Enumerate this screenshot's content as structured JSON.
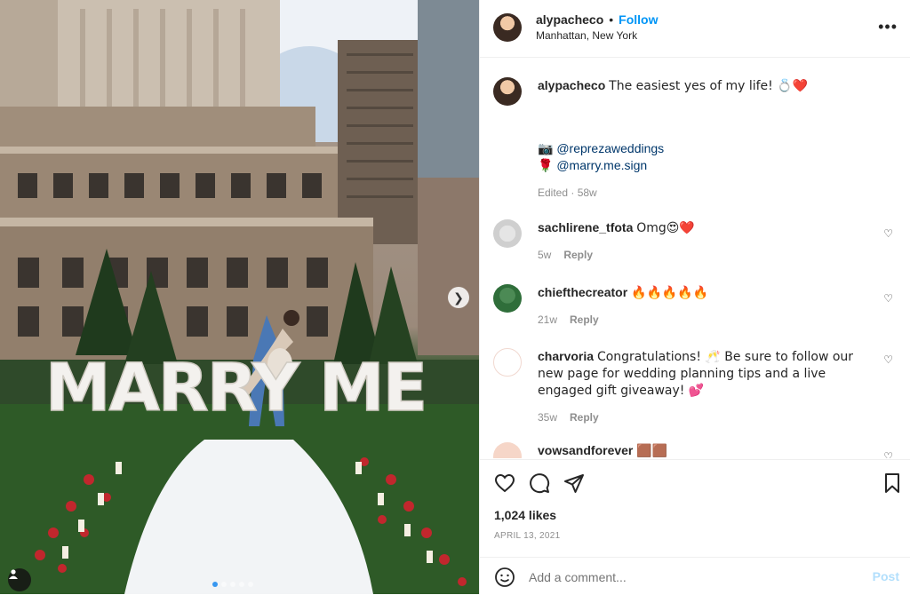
{
  "post": {
    "author": "alypacheco",
    "follow_label": "Follow",
    "location": "Manhattan, New York",
    "caption": {
      "text": "The easiest yes of my life! 💍❤️",
      "credit1_emoji": "📷",
      "credit1": "@reprezaweddings",
      "credit2_emoji": "🌹",
      "credit2": "@marry.me.sign",
      "meta": "Edited · 58w"
    },
    "photo_sign": "MARRY ME",
    "likes": "1,024 likes",
    "date": "APRIL 13, 2021"
  },
  "comments": [
    {
      "user": "sachlirene_tfota",
      "text": "Omg😍❤️",
      "age": "5w",
      "reply": "Reply"
    },
    {
      "user": "chiefthecreator",
      "text": "🔥🔥🔥🔥🔥",
      "age": "21w",
      "reply": "Reply"
    },
    {
      "user": "charvoria",
      "text": "Congratulations! 🥂 Be sure to follow our new page for wedding planning tips and a live engaged gift giveaway! 💕",
      "age": "35w",
      "reply": "Reply"
    },
    {
      "user": "vowsandforever",
      "text": "🟫🟫"
    }
  ],
  "composer": {
    "placeholder": "Add a comment...",
    "post_label": "Post"
  },
  "icons": {
    "more": "more-icon",
    "like": "heart-icon",
    "comment": "comment-icon",
    "share": "share-icon",
    "save": "bookmark-icon",
    "emoji": "emoji-icon",
    "next": "chevron-right-icon"
  },
  "colors": {
    "link": "#0095f6",
    "post_disabled": "#b2dffc",
    "carousel_active": "#3897f0"
  },
  "carousel": {
    "count": 5,
    "active_index": 1
  }
}
